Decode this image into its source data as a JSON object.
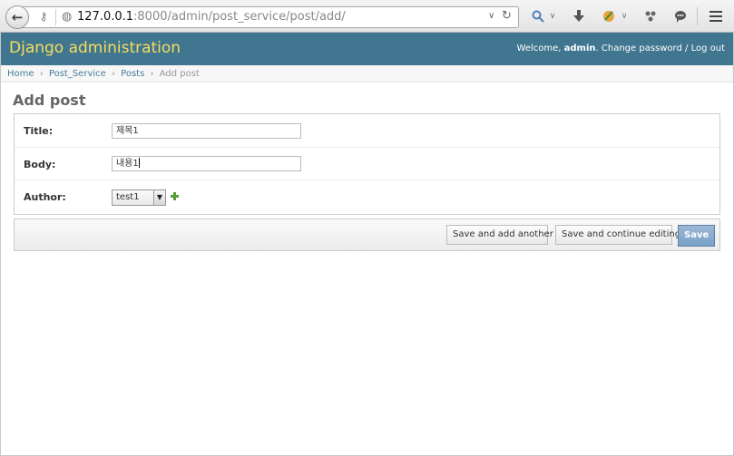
{
  "browser": {
    "url_host": "127.0.0.1",
    "url_rest": ":8000/admin/post_service/post/add/",
    "icons": {
      "back": "back-arrow-icon",
      "identity": "key-icon",
      "globe": "globe-icon",
      "dropdown": "chevron-down-icon",
      "reload": "reload-icon",
      "search": "search-icon",
      "download": "download-icon",
      "addon": "addon-icon",
      "share": "share-icon",
      "chat": "chat-icon",
      "menu": "hamburger-menu-icon"
    }
  },
  "header": {
    "brand": "Django administration",
    "welcome": "Welcome,",
    "username": "admin",
    "change_password": "Change password",
    "separator": "/",
    "logout": "Log out"
  },
  "breadcrumbs": {
    "items": [
      "Home",
      "Post_Service",
      "Posts"
    ],
    "current": "Add post",
    "separator": "›"
  },
  "page": {
    "title": "Add post"
  },
  "form": {
    "fields": [
      {
        "label": "Title:",
        "value": "제목1"
      },
      {
        "label": "Body:",
        "value": "내용1"
      },
      {
        "label": "Author:",
        "value": "test1"
      }
    ]
  },
  "actions": {
    "save_add_another": "Save and add another",
    "save_continue": "Save and continue editing",
    "save": "Save"
  },
  "colors": {
    "header_bg": "#417690",
    "brand": "#f5dd5d",
    "link": "#447e9b",
    "save_bg": "#79a1c8",
    "add_icon": "#5b9a3a"
  }
}
